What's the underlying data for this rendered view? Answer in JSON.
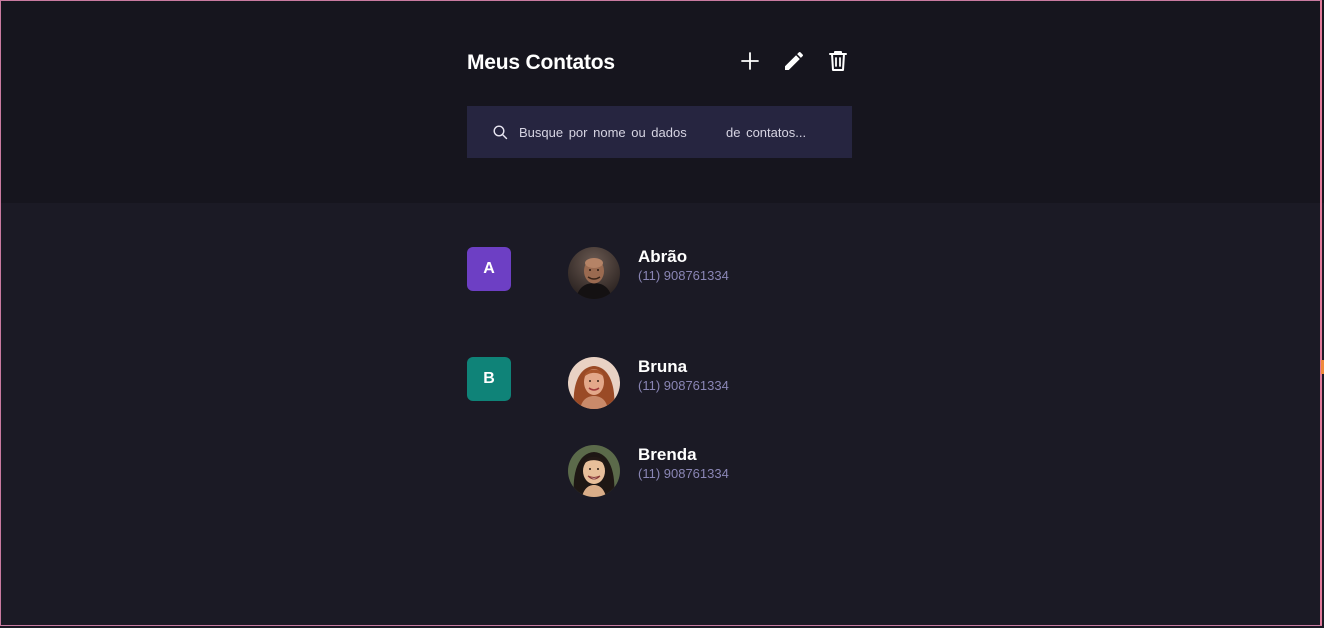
{
  "header": {
    "title": "Meus Contatos",
    "actions": {
      "add_icon": "plus-icon",
      "edit_icon": "pencil-icon",
      "delete_icon": "trash-icon"
    }
  },
  "search": {
    "icon": "search-icon",
    "placeholder": "Busque por nome ou dados       de contatos..."
  },
  "groups": [
    {
      "letter": "A",
      "color": "#6d3fc4",
      "contacts": [
        {
          "name": "Abrão",
          "phone": "(11) 908761334"
        }
      ]
    },
    {
      "letter": "B",
      "color": "#0f8378",
      "contacts": [
        {
          "name": "Bruna",
          "phone": "(11) 908761334"
        },
        {
          "name": "Brenda",
          "phone": "(11) 908761334"
        }
      ]
    }
  ],
  "colors": {
    "header_bg": "#16151e",
    "body_bg": "#1b1a25",
    "search_bg": "#262540",
    "phone_text": "#8a86b5"
  }
}
